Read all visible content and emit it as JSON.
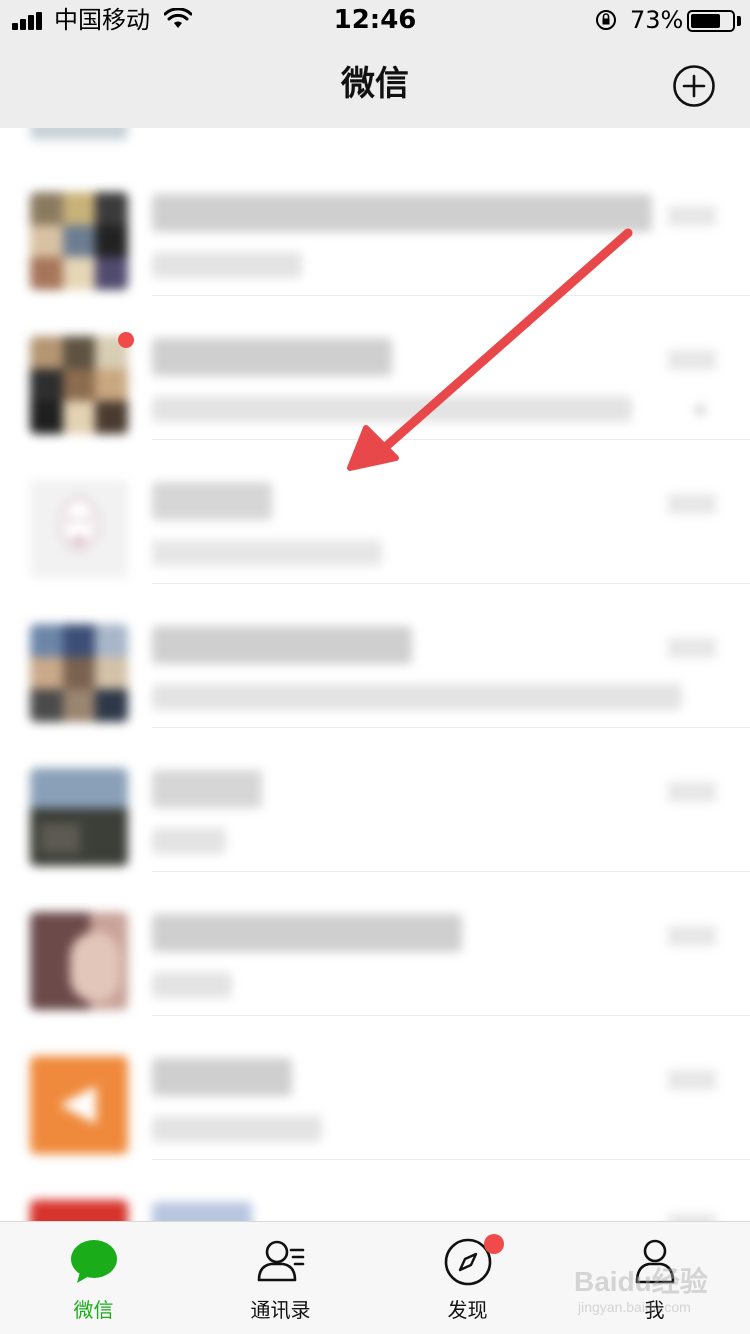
{
  "status_bar": {
    "carrier": "中国移动",
    "time": "12:46",
    "battery_percent": "73%",
    "battery_level": 0.73,
    "signal_icon": "signal-bars-icon",
    "wifi_icon": "wifi-icon",
    "rotation_lock_icon": "rotation-lock-icon"
  },
  "nav": {
    "title": "微信",
    "add_icon": "plus-circle-icon"
  },
  "chats": [
    {
      "name": "",
      "preview": "",
      "time": ""
    },
    {
      "name": "",
      "preview": "",
      "time": "",
      "muted": false
    },
    {
      "name": "",
      "preview": "",
      "time": "",
      "muted": true,
      "badge": true
    },
    {
      "name": "",
      "preview": "",
      "time": ""
    },
    {
      "name": "",
      "preview": "",
      "time": ""
    },
    {
      "name": "",
      "preview": "",
      "time": ""
    },
    {
      "name": "",
      "preview": "",
      "time": ""
    },
    {
      "name": "",
      "preview": "",
      "time": ""
    },
    {
      "name": "",
      "preview": "",
      "time": ""
    }
  ],
  "tabs": [
    {
      "label": "微信",
      "icon": "chat-bubble-icon",
      "active": true
    },
    {
      "label": "通讯录",
      "icon": "contacts-icon",
      "active": false
    },
    {
      "label": "发现",
      "icon": "compass-icon",
      "active": false,
      "badge": true
    },
    {
      "label": "我",
      "icon": "person-icon",
      "active": false
    }
  ],
  "colors": {
    "accent": "#1aad19",
    "badge": "#f14a4a",
    "arrow": "#e8484a",
    "bar_background": "#ededed"
  },
  "watermark": {
    "text": "Baidu经验",
    "sub": "jingyan.baidu.com"
  }
}
